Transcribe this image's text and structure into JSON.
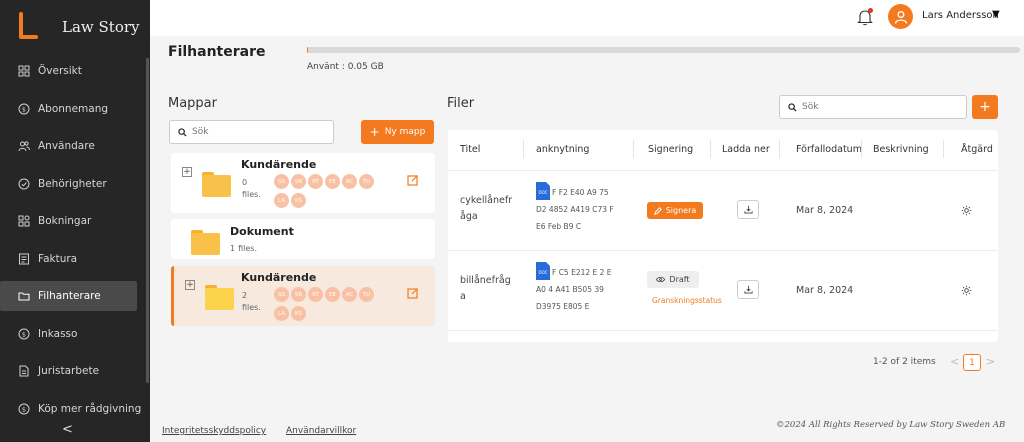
{
  "brand": {
    "name": "Law Story"
  },
  "sidebar": {
    "items": [
      {
        "label": "Översikt",
        "icon": "grid-icon",
        "active": false
      },
      {
        "label": "Abonnemang",
        "icon": "dollar-circle-icon",
        "active": false
      },
      {
        "label": "Användare",
        "icon": "users-icon",
        "active": false
      },
      {
        "label": "Behörigheter",
        "icon": "shield-check-icon",
        "active": false
      },
      {
        "label": "Bokningar",
        "icon": "calendar-grid-icon",
        "active": false
      },
      {
        "label": "Faktura",
        "icon": "invoice-icon",
        "active": false
      },
      {
        "label": "Filhanterare",
        "icon": "folder-icon",
        "active": true
      },
      {
        "label": "Inkasso",
        "icon": "dollar-circle-icon",
        "active": false
      },
      {
        "label": "Juristarbete",
        "icon": "document-icon",
        "active": false
      },
      {
        "label": "Köp mer rådgivning",
        "icon": "dollar-circle-icon",
        "active": false
      }
    ],
    "collapse_label": "<"
  },
  "header": {
    "user_name": "Lars Andersson",
    "caret": "▼"
  },
  "page": {
    "title": "Filhanterare",
    "storage_used_label": "Använt : 0.05 GB",
    "storage_fraction": 0.001
  },
  "folders": {
    "title": "Mappar",
    "search_placeholder": "Sök",
    "new_folder_label": "Ny mapp",
    "items": [
      {
        "name": "Kundärende",
        "count_num": "0",
        "count_word": "files.",
        "expandable": true,
        "chips": [
          "SS",
          "SR",
          "KT",
          "EE",
          "AC",
          "TU",
          "LA",
          "KS"
        ],
        "active": false
      },
      {
        "name": "Dokument",
        "count_num": "1",
        "count_word": "files.",
        "expandable": false,
        "chips": [],
        "active": false
      },
      {
        "name": "Kundärende",
        "count_num": "2",
        "count_word": "files.",
        "expandable": true,
        "chips": [
          "SS",
          "SR",
          "KT",
          "EE",
          "AC",
          "TU",
          "LA",
          "KS"
        ],
        "active": true
      }
    ]
  },
  "files": {
    "title": "Filer",
    "search_placeholder": "Sök",
    "add_label": "+",
    "columns": [
      "Titel",
      "anknytning",
      "Signering",
      "Ladda ner",
      "Förfallodatum",
      "Beskrivning",
      "Åtgärd"
    ],
    "rows": [
      {
        "title_l1": "cykellånefr",
        "title_l2": "åga",
        "doc_badge": "DOC",
        "attach_l1": "F F2 E40 A9 75",
        "attach_l2": "D2 4852 A419 C73 F",
        "attach_l3": "E6 Feb B9 C",
        "sign_label": "Signera",
        "due": "Mar 8, 2024"
      },
      {
        "title_l1": "billånefråg",
        "title_l2": "a",
        "doc_badge": "DOC",
        "attach_l1": "F C5 E212 E 2 E",
        "attach_l2": "A0 4 A41 B505 39",
        "attach_l3": "D3975 E805 E",
        "draft_label": "Draft",
        "status_label": "Granskningsstatus",
        "due": "Mar 8, 2024"
      }
    ]
  },
  "pagination": {
    "info": "1-2 of 2 items",
    "prev": "<",
    "current": "1",
    "next": ">"
  },
  "footer": {
    "privacy": "Integritetsskyddspolicy",
    "terms": "Användarvillkor",
    "copyright": "©2024 All Rights Reserved by Law Story Sweden AB"
  },
  "colors": {
    "accent": "#f47a1f",
    "sidebar_bg": "#262626",
    "chip": "#f9c1a4",
    "folder": "#f9c14a"
  }
}
